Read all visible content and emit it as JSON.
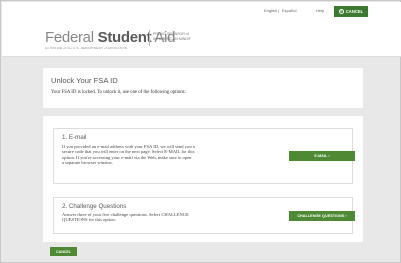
{
  "topbar": {
    "english": "English",
    "sep": "|",
    "espanol": "Español",
    "help": "Help",
    "cancel": "CANCEL"
  },
  "header": {
    "logo_part1": "Federal ",
    "logo_part2": "Student",
    "logo_part3": " Aid",
    "logo_sub": "An OFFICE of the U.S. DEPARTMENT of EDUCATION",
    "sponsor_line1": "PROUD SPONSOR of",
    "sponsor_line2": "the AMERICAN MIND®"
  },
  "intro": {
    "title": "Unlock Your FSA ID",
    "text": "Your FSA ID is locked. To unlock it, use one of the following options:"
  },
  "options": {
    "email": {
      "title": "1. E-mail",
      "line1": "If you provided an e-mail address with your FSA ID, we will send you a",
      "line2": "secure code that you will enter on the next page. Select E-MAIL for this",
      "line3": "option. If you're accessing your e-mail via the Web, make sure to open",
      "line4": "a separate browser window.",
      "button": "E-MAIL ›"
    },
    "challenge": {
      "title": "2. Challenge Questions",
      "line1": "Answer three of your five challenge questions. Select CHALLENGE",
      "line2": "QUESTIONS for this option.",
      "button": "CHALLENGE QUESTIONS ›"
    }
  },
  "footer": {
    "cancel": "CANCEL"
  },
  "colors": {
    "accent_green": "#4e8a34",
    "background": "#e8e8e8"
  }
}
